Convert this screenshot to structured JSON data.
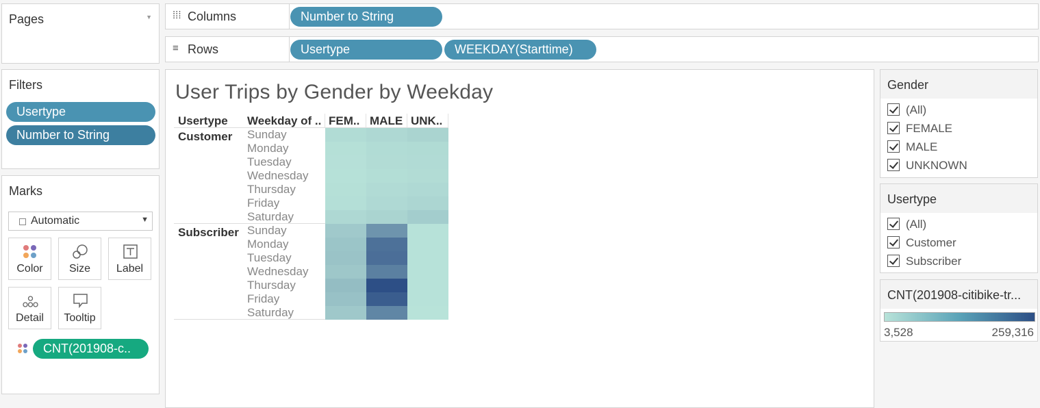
{
  "pages": {
    "title": "Pages"
  },
  "shelves": {
    "columns_label": "Columns",
    "columns_pills": [
      "Number to String"
    ],
    "rows_label": "Rows",
    "rows_pills": [
      "Usertype",
      "WEEKDAY(Starttime)"
    ]
  },
  "filters": {
    "title": "Filters",
    "items": [
      "Usertype",
      "Number to String"
    ]
  },
  "marks": {
    "title": "Marks",
    "type_value": "Automatic",
    "tiles": {
      "color": "Color",
      "size": "Size",
      "label": "Label",
      "detail": "Detail",
      "tooltip": "Tooltip"
    },
    "color_pill": "CNT(201908-c.."
  },
  "view": {
    "title": "User Trips by Gender by Weekday",
    "col_header_usertype": "Usertype",
    "col_header_weekday": "Weekday of ..",
    "gender_headers": [
      "FEM..",
      "MALE",
      "UNK.."
    ],
    "usertypes": [
      "Customer",
      "Subscriber"
    ],
    "weekdays": [
      "Sunday",
      "Monday",
      "Tuesday",
      "Wednesday",
      "Thursday",
      "Friday",
      "Saturday"
    ]
  },
  "chart_data": {
    "type": "heatmap",
    "title": "User Trips by Gender by Weekday",
    "columns": [
      "FEM..",
      "MALE",
      "UNK.."
    ],
    "rows": [
      {
        "usertype": "Customer",
        "weekday": "Sunday",
        "values": [
          16000,
          22000,
          30000
        ]
      },
      {
        "usertype": "Customer",
        "weekday": "Monday",
        "values": [
          9000,
          16000,
          18000
        ]
      },
      {
        "usertype": "Customer",
        "weekday": "Tuesday",
        "values": [
          8000,
          15000,
          17000
        ]
      },
      {
        "usertype": "Customer",
        "weekday": "Wednesday",
        "values": [
          7000,
          13000,
          15000
        ]
      },
      {
        "usertype": "Customer",
        "weekday": "Thursday",
        "values": [
          9000,
          17000,
          20000
        ]
      },
      {
        "usertype": "Customer",
        "weekday": "Friday",
        "values": [
          11000,
          20000,
          26000
        ]
      },
      {
        "usertype": "Customer",
        "weekday": "Saturday",
        "values": [
          22000,
          30000,
          42000
        ]
      },
      {
        "usertype": "Subscriber",
        "weekday": "Sunday",
        "values": [
          48000,
          140000,
          5000
        ]
      },
      {
        "usertype": "Subscriber",
        "weekday": "Monday",
        "values": [
          56000,
          200000,
          5000
        ]
      },
      {
        "usertype": "Subscriber",
        "weekday": "Tuesday",
        "values": [
          58000,
          205000,
          5000
        ]
      },
      {
        "usertype": "Subscriber",
        "weekday": "Wednesday",
        "values": [
          52000,
          175000,
          5000
        ]
      },
      {
        "usertype": "Subscriber",
        "weekday": "Thursday",
        "values": [
          70000,
          259316,
          5000
        ]
      },
      {
        "usertype": "Subscriber",
        "weekday": "Friday",
        "values": [
          62000,
          235000,
          5000
        ]
      },
      {
        "usertype": "Subscriber",
        "weekday": "Saturday",
        "values": [
          50000,
          165000,
          4000
        ]
      }
    ],
    "color_range": [
      3528,
      259316
    ],
    "color_low": "#b8e3d9",
    "color_high": "#2d4f86"
  },
  "gender_filter": {
    "title": "Gender",
    "items": [
      "(All)",
      "FEMALE",
      "MALE",
      "UNKNOWN"
    ]
  },
  "usertype_filter": {
    "title": "Usertype",
    "items": [
      "(All)",
      "Customer",
      "Subscriber"
    ]
  },
  "color_legend": {
    "title": "CNT(201908-citibike-tr...",
    "min_label": "3,528",
    "max_label": "259,316"
  }
}
